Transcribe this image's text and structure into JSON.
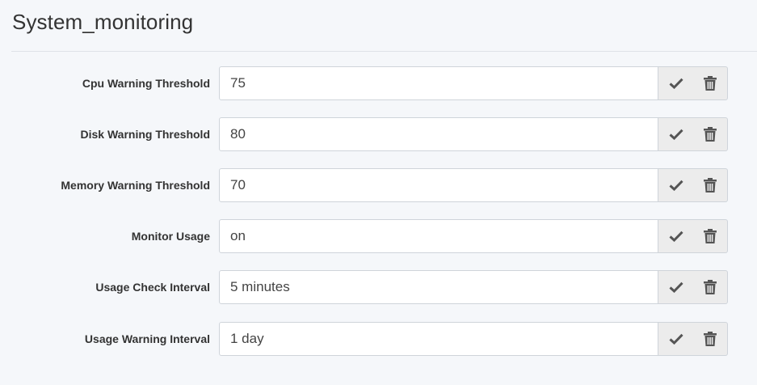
{
  "page": {
    "title": "System_monitoring"
  },
  "settings": [
    {
      "label": "Cpu Warning Threshold",
      "value": "75"
    },
    {
      "label": "Disk Warning Threshold",
      "value": "80"
    },
    {
      "label": "Memory Warning Threshold",
      "value": "70"
    },
    {
      "label": "Monitor Usage",
      "value": "on"
    },
    {
      "label": "Usage Check Interval",
      "value": "5 minutes"
    },
    {
      "label": "Usage Warning Interval",
      "value": "1 day"
    }
  ],
  "icons": {
    "save": "checkmark-icon",
    "delete": "trash-icon"
  },
  "colors": {
    "background": "#f5f7fa",
    "button_background": "#ececec",
    "icon": "#555555"
  }
}
